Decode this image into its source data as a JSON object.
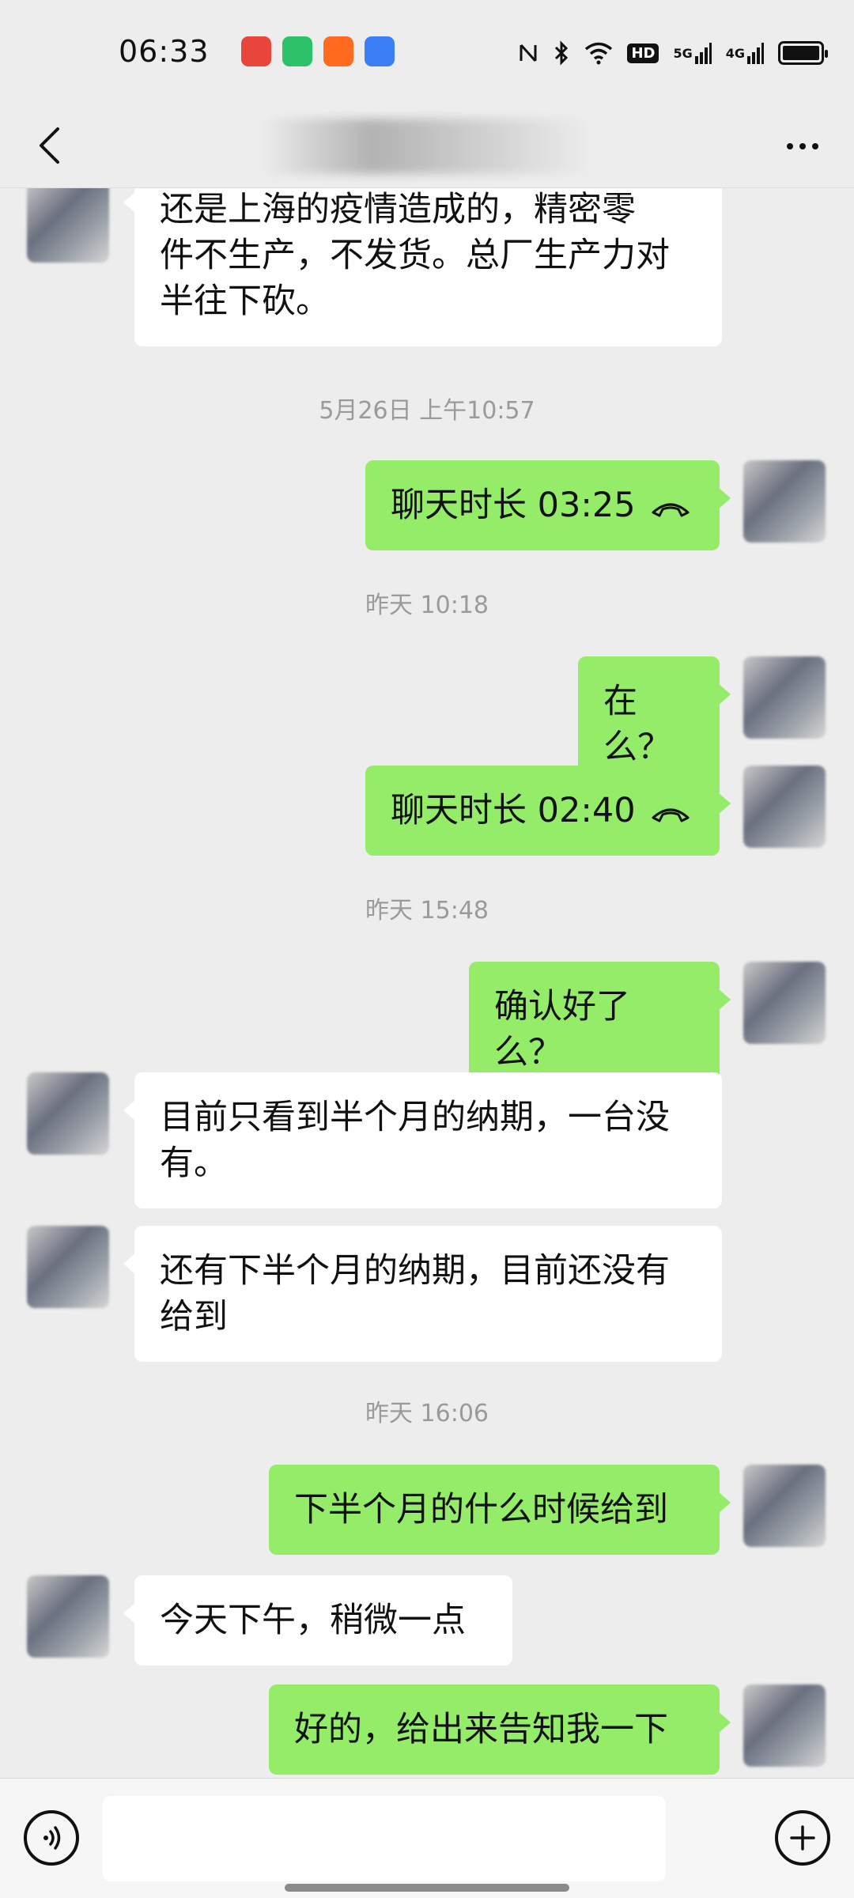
{
  "status_bar": {
    "time": "06:33",
    "notification_icons": [
      "baidu-app-icon",
      "green-app-icon",
      "kuaishou-app-icon",
      "blue-app-icon"
    ],
    "hd_label": "HD",
    "net1": "5G",
    "net2": "4G"
  },
  "header": {
    "title": ""
  },
  "messages": [
    {
      "side": "in",
      "text": "还是上海的疫情造成的，精密零件不生产，不发货。总厂生产力对半往下砍。"
    },
    {
      "timestamp": "5月26日 上午10:57"
    },
    {
      "side": "out",
      "text": "聊天时长 03:25",
      "call": true
    },
    {
      "timestamp": "昨天 10:18"
    },
    {
      "side": "out",
      "text": "在么？"
    },
    {
      "side": "out",
      "text": "聊天时长 02:40",
      "call": true
    },
    {
      "timestamp": "昨天 15:48"
    },
    {
      "side": "out",
      "text": "确认好了么？"
    },
    {
      "side": "in",
      "text": "目前只看到半个月的纳期，一台没有。"
    },
    {
      "side": "in",
      "text": "还有下半个月的纳期，目前还没有给到"
    },
    {
      "timestamp": "昨天 16:06"
    },
    {
      "side": "out",
      "text": "下半个月的什么时候给到"
    },
    {
      "side": "in",
      "text": "今天下午，稍微一点"
    },
    {
      "side": "out",
      "text": "好的，给出来告知我一下"
    }
  ],
  "chat": {
    "m0_line1": "还是上海的疫情造成的，精密零",
    "m0_line2": "件不生产，不发货。总厂生产力对",
    "m0_line3": "半往下砍。",
    "ts1": "5月26日 上午10:57",
    "m1": "聊天时长 03:25",
    "ts2": "昨天 10:18",
    "m2": "在么？",
    "m3": "聊天时长 02:40",
    "ts3": "昨天 15:48",
    "m4": "确认好了么？",
    "m5_line1": "目前只看到半个月的纳期，一台没",
    "m5_line2": "有。",
    "m6_line1": "还有下半个月的纳期，目前还没有",
    "m6_line2": "给到",
    "ts4": "昨天 16:06",
    "m7": "下半个月的什么时候给到",
    "m8": "今天下午，稍微一点",
    "m9": "好的，给出来告知我一下"
  },
  "colors": {
    "outgoing_bubble": "#95ec69",
    "incoming_bubble": "#ffffff",
    "background": "#ededed"
  }
}
